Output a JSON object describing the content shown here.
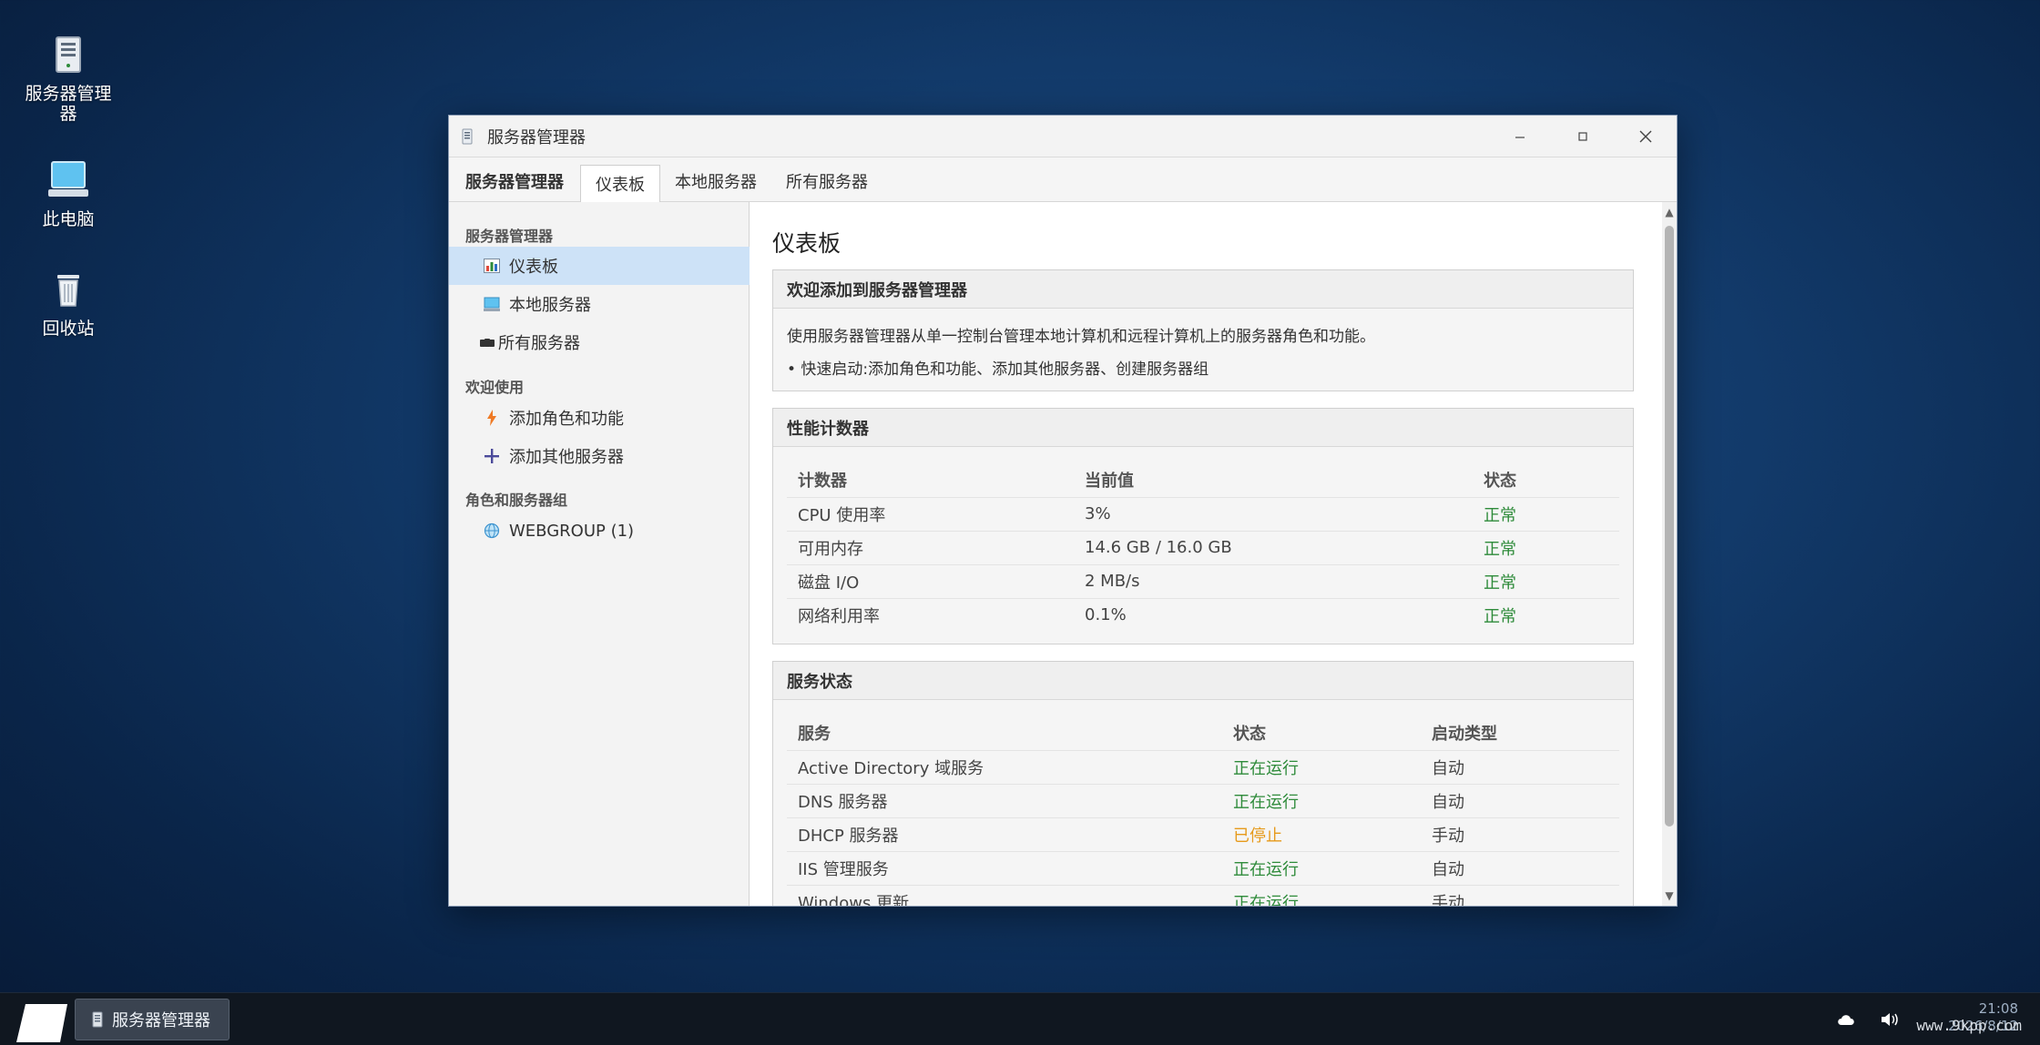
{
  "desktop": {
    "icons": [
      {
        "label": "服务器管理器",
        "icon": "server-manager-icon"
      },
      {
        "label": "此电脑",
        "icon": "computer-icon"
      },
      {
        "label": "回收站",
        "icon": "recycle-bin-icon"
      }
    ]
  },
  "window": {
    "title": "服务器管理器",
    "controls": {
      "minimize": "–",
      "maximize": "☐",
      "close": "✕"
    },
    "tabs": {
      "brand": "服务器管理器",
      "dashboard": "仪表板",
      "local": "本地服务器",
      "all": "所有服务器"
    },
    "sidebar": {
      "section1": "服务器管理器",
      "dashboard": "仪表板",
      "local": "本地服务器",
      "all": "所有服务器",
      "section2": "欢迎使用",
      "add_roles": "添加角色和功能",
      "add_servers": "添加其他服务器",
      "section3": "角色和服务器组",
      "webgroup": "WEBGROUP (1)"
    },
    "content": {
      "title": "仪表板",
      "welcome": {
        "header": "欢迎添加到服务器管理器",
        "line1": "使用服务器管理器从单一控制台管理本地计算机和远程计算机上的服务器角色和功能。",
        "line2": "• 快速启动:添加角色和功能、添加其他服务器、创建服务器组"
      },
      "perf": {
        "header": "性能计数器",
        "columns": {
          "counter": "计数器",
          "value": "当前值",
          "status": "状态"
        },
        "rows": [
          {
            "counter": "CPU 使用率",
            "value": "3%",
            "status": "正常"
          },
          {
            "counter": "可用内存",
            "value": "14.6 GB / 16.0 GB",
            "status": "正常"
          },
          {
            "counter": "磁盘 I/O",
            "value": "2 MB/s",
            "status": "正常"
          },
          {
            "counter": "网络利用率",
            "value": "0.1%",
            "status": "正常"
          }
        ]
      },
      "services": {
        "header": "服务状态",
        "columns": {
          "service": "服务",
          "status": "状态",
          "startup": "启动类型"
        },
        "rows": [
          {
            "service": "Active Directory 域服务",
            "status": "正在运行",
            "startup": "自动"
          },
          {
            "service": "DNS 服务器",
            "status": "正在运行",
            "startup": "自动"
          },
          {
            "service": "DHCP 服务器",
            "status": "已停止",
            "startup": "手动"
          },
          {
            "service": "IIS 管理服务",
            "status": "正在运行",
            "startup": "自动"
          },
          {
            "service": "Windows 更新",
            "status": "正在运行",
            "startup": "手动"
          }
        ]
      }
    }
  },
  "taskbar": {
    "task_label": "服务器管理器",
    "time": "21:08",
    "date": "2026/8/12",
    "watermark": "www.9kpp.com"
  },
  "colors": {
    "ok": "#2e8b3a",
    "warn": "#e69a1b",
    "selected": "#cde2f7"
  }
}
